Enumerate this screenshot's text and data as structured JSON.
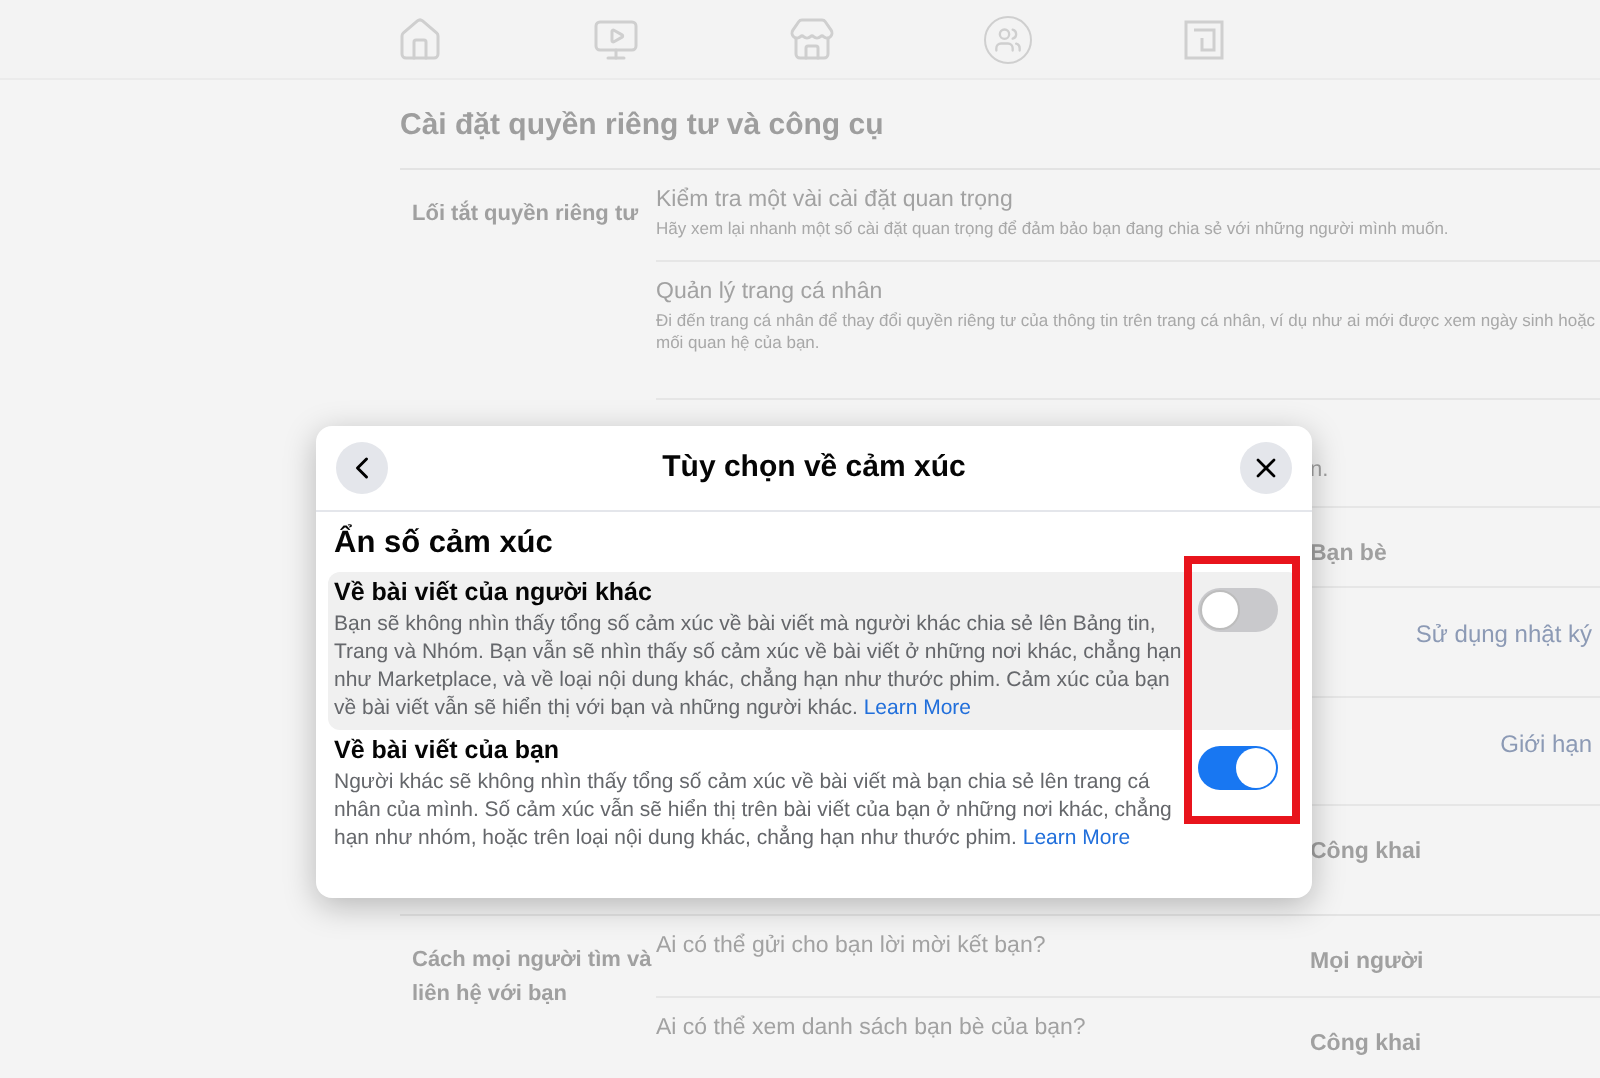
{
  "background": {
    "title": "Cài đặt quyền riêng tư và công cụ",
    "sections": [
      {
        "label": "Lối tắt quyền riêng tư",
        "rows": [
          {
            "title": "Kiểm tra một vài cài đặt quan trọng",
            "description": "Hãy xem lại nhanh một số cài đặt quan trọng để đảm bảo bạn đang chia sẻ với những người mình muốn."
          },
          {
            "title": "Quản lý trang cá nhân",
            "description": "Đi đến trang cá nhân để thay đổi quyền riêng tư của thông tin trên trang cá nhân, ví dụ như ai mới được xem ngày sinh hoặc mối quan hệ của bạn."
          },
          {
            "fragment": "n."
          },
          {
            "value": "Bạn bè"
          },
          {
            "link": "Sử dụng nhật ký"
          },
          {
            "link": "Giới hạn"
          },
          {
            "value": "Công khai"
          }
        ]
      },
      {
        "label": "Cách mọi người tìm và liên hệ với bạn",
        "rows": [
          {
            "title": "Ai có thể gửi cho bạn lời mời kết bạn?",
            "value": "Mọi người"
          },
          {
            "title": "Ai có thể xem danh sách bạn bè của bạn?",
            "value": "Công khai"
          }
        ]
      }
    ]
  },
  "dialog": {
    "title": "Tùy chọn về cảm xúc",
    "heading": "Ẩn số cảm xúc",
    "options": [
      {
        "title": "Về bài viết của người khác",
        "description": "Bạn sẽ không nhìn thấy tổng số cảm xúc về bài viết mà người khác chia sẻ lên Bảng tin, Trang và Nhóm. Bạn vẫn sẽ nhìn thấy số cảm xúc về bài viết ở những nơi khác, chẳng hạn như Marketplace, và về loại nội dung khác, chẳng hạn như thước phim. Cảm xúc của bạn về bài viết vẫn sẽ hiển thị với bạn và những người khác.",
        "link": "Learn More",
        "on": false,
        "selected": true
      },
      {
        "title": "Về bài viết của bạn",
        "description": "Người khác sẽ không nhìn thấy tổng số cảm xúc về bài viết mà bạn chia sẻ lên trang cá nhân của mình. Số cảm xúc vẫn sẽ hiển thị trên bài viết của bạn ở những nơi khác, chẳng hạn như nhóm, hoặc trên loại nội dung khác, chẳng hạn như thước phim.",
        "link": "Learn More",
        "on": true,
        "selected": false
      }
    ]
  }
}
